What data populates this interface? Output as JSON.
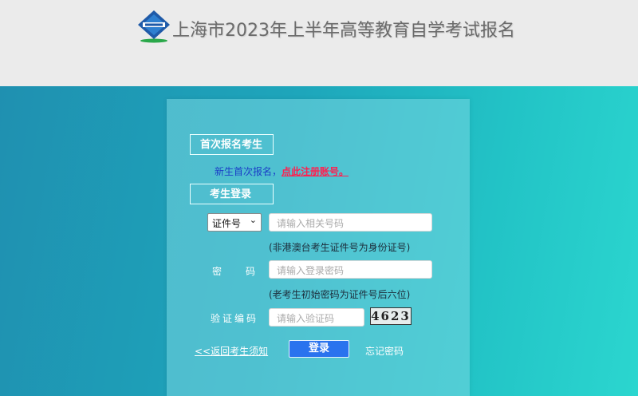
{
  "header": {
    "title": "上海市2023年上半年高等教育自学考试报名",
    "logo_icon": "exam-office-logo-icon"
  },
  "first_registration": {
    "section_label": "首次报名考生",
    "prompt": "新生首次报名，",
    "register_link": "点此注册账号。"
  },
  "login": {
    "section_label": "考生登录",
    "id_type": {
      "selected": "证件号",
      "icon": "chevron-down-icon"
    },
    "id_input": {
      "placeholder": "请输入相关号码",
      "value": ""
    },
    "id_hint": "(非港澳台考生证件号为身份证号)",
    "password_label": "密码",
    "password_input": {
      "placeholder": "请输入登录密码",
      "value": ""
    },
    "password_hint": "(老考生初始密码为证件号后六位)",
    "captcha_label": "验证编码",
    "captcha_input": {
      "placeholder": "请输入验证码",
      "value": ""
    },
    "captcha_text": "4623",
    "back_link": "<<返回考生须知",
    "login_button": "登录",
    "forgot_link": "忘记密码"
  },
  "colors": {
    "accent_button": "#2a73ee",
    "register_link": "#ff1f4f",
    "background_start": "#1f8fb0",
    "background_end": "#2bd6cf",
    "header_bg": "#ebebeb"
  }
}
